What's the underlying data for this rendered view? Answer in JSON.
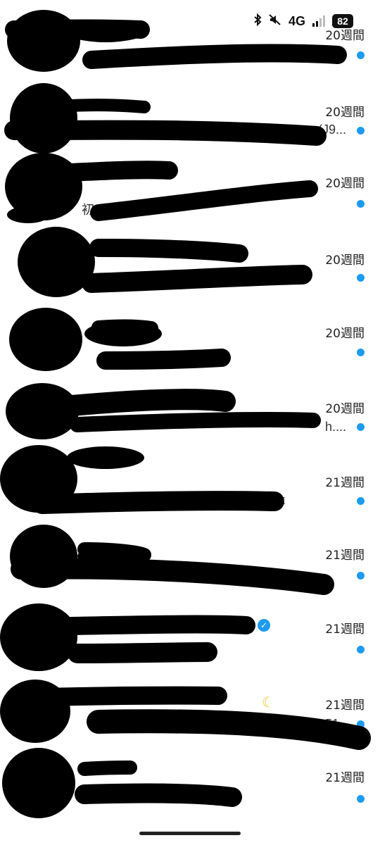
{
  "status_bar": {
    "network": "4G",
    "battery": "82",
    "icons": [
      "bluetooth-icon",
      "muted-icon",
      "signal-icon",
      "battery-icon"
    ]
  },
  "accent_color": "#1d9bf0",
  "conversations": [
    {
      "time": "20週間",
      "snippet": "",
      "unread": true
    },
    {
      "time": "20週間",
      "snippet": "(J9...",
      "unread": true
    },
    {
      "time": "20週間",
      "snippet": "初 ...",
      "unread": true
    },
    {
      "time": "20週間",
      "snippet": "",
      "unread": true
    },
    {
      "time": "20週間",
      "snippet": "",
      "unread": true
    },
    {
      "time": "20週間",
      "snippet": "h....",
      "unread": true
    },
    {
      "time": "21週間",
      "snippet": "k",
      "unread": true
    },
    {
      "time": "21週間",
      "snippet": "",
      "unread": true
    },
    {
      "time": "21週間",
      "snippet": "",
      "unread": true,
      "verified": true
    },
    {
      "time": "21週間",
      "snippet": "51...",
      "unread": true,
      "emoji": "moon-icon"
    },
    {
      "time": "21週間",
      "snippet": "",
      "unread": true
    }
  ]
}
